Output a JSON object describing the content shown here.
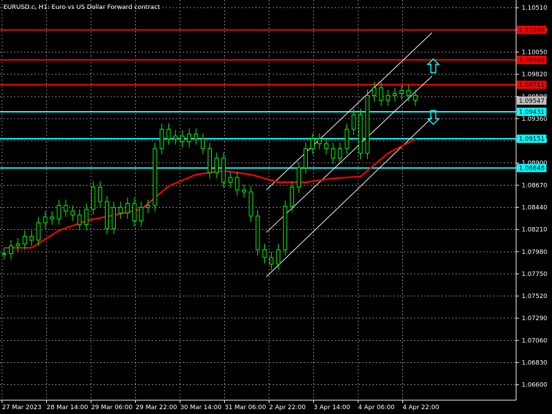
{
  "chart_data": {
    "type": "candlestick",
    "title": "EURUSD.c, H1:  Euro vs US Dollar Forward contract",
    "ylim": [
      1.0644,
      1.1059
    ],
    "y_ticks": [
      "1.10510",
      "1.10280",
      "1.10050",
      "1.09820",
      "1.09590",
      "1.09360",
      "1.09130",
      "1.08900",
      "1.08670",
      "1.08440",
      "1.08210",
      "1.07980",
      "1.07750",
      "1.07520",
      "1.07290",
      "1.07060",
      "1.06830",
      "1.06600"
    ],
    "x_tick_labels": [
      "27 Mar 2023",
      "28 Mar 14:00",
      "29 Mar 06:00",
      "29 Mar 22:00",
      "30 Mar 14:00",
      "31 Mar 06:00",
      "2 Apr 22:00",
      "3 Apr 14:00",
      "4 Apr 06:00",
      "4 Apr 22:00"
    ],
    "grid": true,
    "colors": {
      "background": "#000000",
      "grid": "#8a8a8a",
      "candle": "#00ff00",
      "ma_line": "#ff0000",
      "resistance": "#ff0000",
      "support": "#00ffff",
      "channel": "#ffffff",
      "current_price_tag": "#c0c0c0"
    },
    "price_series": [
      {
        "x": "27 Mar 2023",
        "y": 1.0796
      },
      {
        "x": "27 Mar",
        "y": 1.0804
      },
      {
        "x": "27 Mar",
        "y": 1.0806
      },
      {
        "x": "27 Mar",
        "y": 1.0814
      },
      {
        "x": "28 Mar",
        "y": 1.081
      },
      {
        "x": "28 Mar",
        "y": 1.0828
      },
      {
        "x": "28 Mar",
        "y": 1.0834
      },
      {
        "x": "28 Mar",
        "y": 1.0832
      },
      {
        "x": "28 Mar 14:00",
        "y": 1.0846
      },
      {
        "x": "28 Mar",
        "y": 1.084
      },
      {
        "x": "28 Mar",
        "y": 1.0836
      },
      {
        "x": "29 Mar",
        "y": 1.0826
      },
      {
        "x": "29 Mar",
        "y": 1.0842
      },
      {
        "x": "29 Mar 06:00",
        "y": 1.0865
      },
      {
        "x": "29 Mar",
        "y": 1.085
      },
      {
        "x": "29 Mar",
        "y": 1.0822
      },
      {
        "x": "29 Mar",
        "y": 1.0844
      },
      {
        "x": "29 Mar",
        "y": 1.0838
      },
      {
        "x": "29 Mar",
        "y": 1.0848
      },
      {
        "x": "29 Mar 22:00",
        "y": 1.083
      },
      {
        "x": "30 Mar",
        "y": 1.0844
      },
      {
        "x": "30 Mar",
        "y": 1.0846
      },
      {
        "x": "30 Mar",
        "y": 1.0905
      },
      {
        "x": "30 Mar",
        "y": 1.0925
      },
      {
        "x": "30 Mar",
        "y": 1.0915
      },
      {
        "x": "30 Mar 14:00",
        "y": 1.0918
      },
      {
        "x": "30 Mar",
        "y": 1.0912
      },
      {
        "x": "30 Mar",
        "y": 1.092
      },
      {
        "x": "31 Mar",
        "y": 1.0915
      },
      {
        "x": "31 Mar",
        "y": 1.0905
      },
      {
        "x": "31 Mar",
        "y": 1.088
      },
      {
        "x": "31 Mar 06:00",
        "y": 1.0895
      },
      {
        "x": "31 Mar",
        "y": 1.087
      },
      {
        "x": "31 Mar",
        "y": 1.0875
      },
      {
        "x": "31 Mar",
        "y": 1.0862
      },
      {
        "x": "31 Mar",
        "y": 1.086
      },
      {
        "x": "2 Apr",
        "y": 1.0835
      },
      {
        "x": "2 Apr",
        "y": 1.08
      },
      {
        "x": "2 Apr",
        "y": 1.0792
      },
      {
        "x": "2 Apr 22:00",
        "y": 1.0785
      },
      {
        "x": "3 Apr",
        "y": 1.08
      },
      {
        "x": "3 Apr",
        "y": 1.0845
      },
      {
        "x": "3 Apr",
        "y": 1.0865
      },
      {
        "x": "3 Apr",
        "y": 1.0885
      },
      {
        "x": "3 Apr 14:00",
        "y": 1.0905
      },
      {
        "x": "3 Apr",
        "y": 1.0915
      },
      {
        "x": "3 Apr",
        "y": 1.091
      },
      {
        "x": "3 Apr",
        "y": 1.0905
      },
      {
        "x": "3 Apr",
        "y": 1.0895
      },
      {
        "x": "4 Apr",
        "y": 1.0905
      },
      {
        "x": "4 Apr",
        "y": 1.0925
      },
      {
        "x": "4 Apr",
        "y": 1.094
      },
      {
        "x": "4 Apr 06:00",
        "y": 1.09
      },
      {
        "x": "4 Apr",
        "y": 1.096
      },
      {
        "x": "4 Apr",
        "y": 1.0968
      },
      {
        "x": "4 Apr",
        "y": 1.0955
      },
      {
        "x": "4 Apr",
        "y": 1.096
      },
      {
        "x": "4 Apr",
        "y": 1.0962
      },
      {
        "x": "4 Apr 22:00",
        "y": 1.0965
      },
      {
        "x": "4 Apr",
        "y": 1.096
      },
      {
        "x": "5 Apr",
        "y": 1.0955
      }
    ],
    "moving_average": [
      {
        "x": "27 Mar 2023",
        "y": 1.0802
      },
      {
        "x": "28 Mar",
        "y": 1.0802
      },
      {
        "x": "28 Mar 14:00",
        "y": 1.082
      },
      {
        "x": "29 Mar 06:00",
        "y": 1.083
      },
      {
        "x": "29 Mar 22:00",
        "y": 1.0836
      },
      {
        "x": "30 Mar",
        "y": 1.0842
      },
      {
        "x": "30 Mar 14:00",
        "y": 1.0866
      },
      {
        "x": "31 Mar",
        "y": 1.0878
      },
      {
        "x": "31 Mar 06:00",
        "y": 1.0882
      },
      {
        "x": "2 Apr",
        "y": 1.0878
      },
      {
        "x": "2 Apr 22:00",
        "y": 1.087
      },
      {
        "x": "3 Apr 14:00",
        "y": 1.087
      },
      {
        "x": "4 Apr",
        "y": 1.0874
      },
      {
        "x": "4 Apr 06:00",
        "y": 1.0876
      },
      {
        "x": "4 Apr 22:00",
        "y": 1.09
      },
      {
        "x": "5 Apr",
        "y": 1.0915
      }
    ],
    "horizontal_levels": [
      {
        "price": 1.1028,
        "label": "1.10280",
        "role": "resistance"
      },
      {
        "price": 1.09969,
        "label": "1.09969",
        "role": "resistance"
      },
      {
        "price": 1.09711,
        "label": "1.09711",
        "role": "resistance"
      },
      {
        "price": 1.09431,
        "label": "1.09431",
        "role": "support"
      },
      {
        "price": 1.09151,
        "label": "1.09151",
        "role": "support"
      },
      {
        "price": 1.08848,
        "label": "1.08848",
        "role": "support"
      }
    ],
    "current_price": {
      "price": 1.09547,
      "label": "1.09547"
    },
    "arrows": [
      {
        "direction": "up",
        "icon": "arrow-up-outline",
        "price": 1.099
      },
      {
        "direction": "down",
        "icon": "arrow-down-outline",
        "price": 1.0938
      }
    ],
    "channel_lines": [
      {
        "from": {
          "x": "2 Apr",
          "y": 1.0862
        },
        "to": {
          "x": "5 Apr",
          "y": 1.1025
        }
      },
      {
        "from": {
          "x": "2 Apr",
          "y": 1.0818
        },
        "to": {
          "x": "5 Apr",
          "y": 1.098
        }
      },
      {
        "from": {
          "x": "2 Apr",
          "y": 1.0772
        },
        "to": {
          "x": "5 Apr",
          "y": 1.0937
        }
      }
    ]
  }
}
